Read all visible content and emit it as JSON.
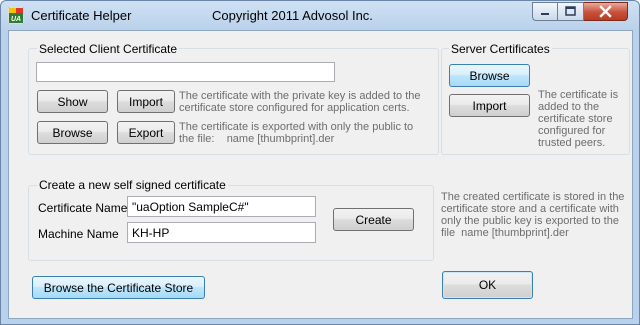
{
  "window": {
    "title": "Certificate Helper",
    "copyright": "Copyright 2011 Advosol Inc."
  },
  "client_group": {
    "title": "Selected Client Certificate",
    "path_value": "",
    "show_label": "Show",
    "import_label": "Import",
    "browse_label": "Browse",
    "export_label": "Export",
    "import_desc": "The certificate with the private key is added to the\ncertificate store configured for application certs.",
    "export_desc": "The certificate is exported with only the public to\nthe file:    name [thumbprint].der"
  },
  "server_group": {
    "title": "Server Certificates",
    "browse_label": "Browse",
    "import_label": "Import",
    "import_desc": "The certificate is\nadded to the\ncertificate store\nconfigured for\ntrusted peers."
  },
  "create_group": {
    "title": "Create a new self signed certificate",
    "cert_name_label": "Certificate Name",
    "cert_name_value": "\"uaOption SampleC#\"",
    "machine_name_label": "Machine Name",
    "machine_name_value": "KH-HP",
    "create_label": "Create",
    "create_desc": "The created certificate is stored in the\ncertificate store and a certificate with\nonly the public key is exported to the\nfile  name [thumbprint].der"
  },
  "footer": {
    "browse_store_label": "Browse the Certificate Store",
    "ok_label": "OK"
  },
  "colors": {
    "close_button": "#c7513b",
    "focus_border": "#3c7fb1",
    "description_text": "#6d6d6d"
  }
}
